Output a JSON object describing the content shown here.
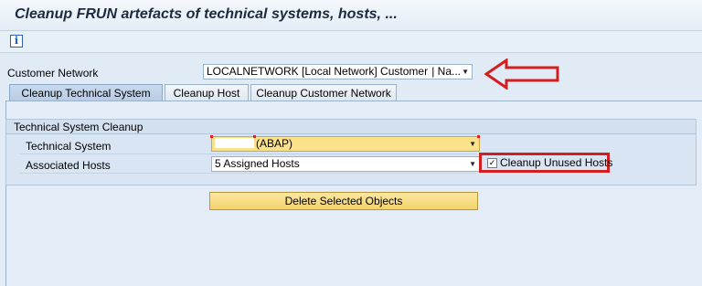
{
  "window": {
    "title": "Cleanup FRUN artefacts of technical systems, hosts, ..."
  },
  "toolbar": {
    "info_icon_glyph": "i",
    "info_icon_name": "info-icon"
  },
  "customer_network": {
    "label": "Customer Network",
    "value": "LOCALNETWORK [Local Network] Customer",
    "value_suffix": "| Na...",
    "arrow_glyph": "▼"
  },
  "tabs": [
    {
      "label": "Cleanup Technical System",
      "active": true
    },
    {
      "label": "Cleanup Host",
      "active": false
    },
    {
      "label": "Cleanup Customer Network",
      "active": false
    }
  ],
  "group": {
    "title": "Technical System Cleanup",
    "technical_system": {
      "label": "Technical System",
      "value": "(ABAP)",
      "arrow_glyph": "▼"
    },
    "associated_hosts": {
      "label": "Associated Hosts",
      "value": "5 Assigned Hosts",
      "arrow_glyph": "▼"
    },
    "cleanup_unused_hosts": {
      "label": "Cleanup Unused Hosts",
      "checked": true,
      "check_glyph": "✓"
    }
  },
  "actions": {
    "delete_label": "Delete Selected Objects"
  },
  "colors": {
    "annotation_red": "#d11f1f",
    "highlight_yellow": "#fbe28a",
    "panel_blue": "#e1ebf6"
  }
}
